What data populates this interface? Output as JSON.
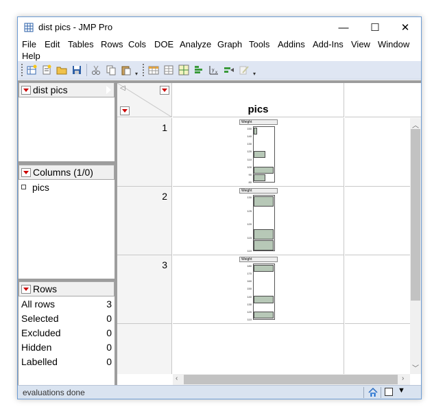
{
  "window": {
    "title": "dist pics - JMP Pro",
    "controls": {
      "minimize": "—",
      "maximize": "☐",
      "close": "✕"
    }
  },
  "menu": [
    "File",
    "Edit",
    "Tables",
    "Rows",
    "Cols",
    "DOE",
    "Analyze",
    "Graph",
    "Tools",
    "Addins",
    "Add-Ins",
    "View",
    "Window",
    "Help"
  ],
  "toolbar": {
    "icons": [
      "new-data-table-icon",
      "new-script-icon",
      "open-icon",
      "save-icon",
      "cut-icon",
      "copy-icon",
      "paste-icon",
      "data-table-icon",
      "column-info-icon",
      "graph-builder-icon",
      "distribution-icon",
      "fit-y-by-x-icon",
      "fit-model-icon",
      "edit-icon"
    ]
  },
  "left_panel": {
    "table": {
      "name": "dist pics"
    },
    "columns": {
      "header": "Columns (1/0)",
      "items": [
        "pics"
      ]
    },
    "rows": {
      "header": "Rows",
      "items": [
        {
          "label": "All rows",
          "value": "3"
        },
        {
          "label": "Selected",
          "value": "0"
        },
        {
          "label": "Excluded",
          "value": "0"
        },
        {
          "label": "Hidden",
          "value": "0"
        },
        {
          "label": "Labelled",
          "value": "0"
        }
      ]
    }
  },
  "grid": {
    "column_header": "pics",
    "rows": [
      {
        "number": "1",
        "chart_title": "Weight",
        "ticks": [
          "150",
          "140",
          "130",
          "120",
          "110",
          "100",
          "90",
          "80"
        ],
        "bars": [
          0.15,
          0,
          0,
          0.55,
          0,
          0.95,
          0.55
        ]
      },
      {
        "number": "2",
        "chart_title": "Weight",
        "ticks": [
          "130",
          "125",
          "120",
          "115",
          "110"
        ],
        "bars": [
          0.95,
          0,
          0,
          0.95,
          0.95
        ]
      },
      {
        "number": "3",
        "chart_title": "Weight",
        "ticks": [
          "180",
          "170",
          "160",
          "150",
          "140",
          "130",
          "120",
          "110"
        ],
        "bars": [
          0.95,
          0,
          0,
          0,
          0.95,
          0,
          0.95
        ]
      }
    ]
  },
  "status": {
    "text": "evaluations done"
  }
}
